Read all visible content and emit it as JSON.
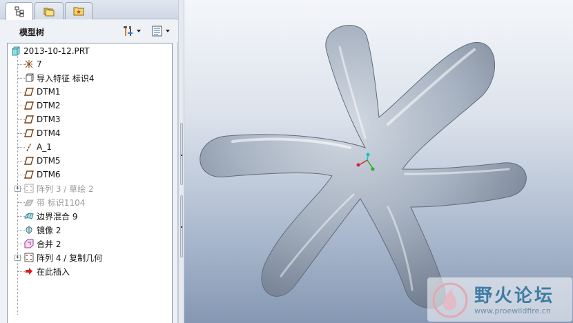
{
  "panel": {
    "title": "模型树",
    "tabs": [
      {
        "icon": "model-tree-icon",
        "active": true
      },
      {
        "icon": "folder-browser-icon",
        "active": false
      },
      {
        "icon": "favorites-icon",
        "active": false
      }
    ],
    "header_buttons": [
      {
        "icon": "settings-tools-icon"
      },
      {
        "icon": "show-options-icon"
      }
    ]
  },
  "tree": {
    "root": {
      "label": "2013-10-12.PRT",
      "icon": "part-icon"
    },
    "items": [
      {
        "label": "7",
        "icon": "csys-icon",
        "dim": false,
        "expandable": false
      },
      {
        "label": "导入特征 标识4",
        "icon": "import-feature-icon",
        "dim": false,
        "expandable": false
      },
      {
        "label": "DTM1",
        "icon": "datum-plane-icon",
        "dim": false,
        "expandable": false
      },
      {
        "label": "DTM2",
        "icon": "datum-plane-icon",
        "dim": false,
        "expandable": false
      },
      {
        "label": "DTM3",
        "icon": "datum-plane-icon",
        "dim": false,
        "expandable": false
      },
      {
        "label": "DTM4",
        "icon": "datum-plane-icon",
        "dim": false,
        "expandable": false
      },
      {
        "label": "A_1",
        "icon": "datum-axis-icon",
        "dim": false,
        "expandable": false
      },
      {
        "label": "DTM5",
        "icon": "datum-plane-icon",
        "dim": false,
        "expandable": false
      },
      {
        "label": "DTM6",
        "icon": "datum-plane-icon",
        "dim": false,
        "expandable": false
      },
      {
        "label": "阵列 3 / 草绘 2",
        "icon": "pattern-icon",
        "dim": true,
        "expandable": true
      },
      {
        "label": "带 标识1104",
        "icon": "ribbon-icon",
        "dim": true,
        "expandable": false
      },
      {
        "label": "边界混合 9",
        "icon": "boundary-blend-icon",
        "dim": false,
        "expandable": false
      },
      {
        "label": "镜像 2",
        "icon": "mirror-icon",
        "dim": false,
        "expandable": false
      },
      {
        "label": "合并 2",
        "icon": "merge-icon",
        "dim": false,
        "expandable": false
      },
      {
        "label": "阵列 4 / 复制几何",
        "icon": "pattern-icon",
        "dim": false,
        "expandable": true
      },
      {
        "label": "在此插入",
        "icon": "insert-here-arrow-icon",
        "dim": false,
        "expandable": false
      }
    ]
  },
  "viewport": {
    "model": "starfish-surface",
    "watermark": {
      "title": "野火论坛",
      "url": "www.proewildfire.cn"
    }
  }
}
